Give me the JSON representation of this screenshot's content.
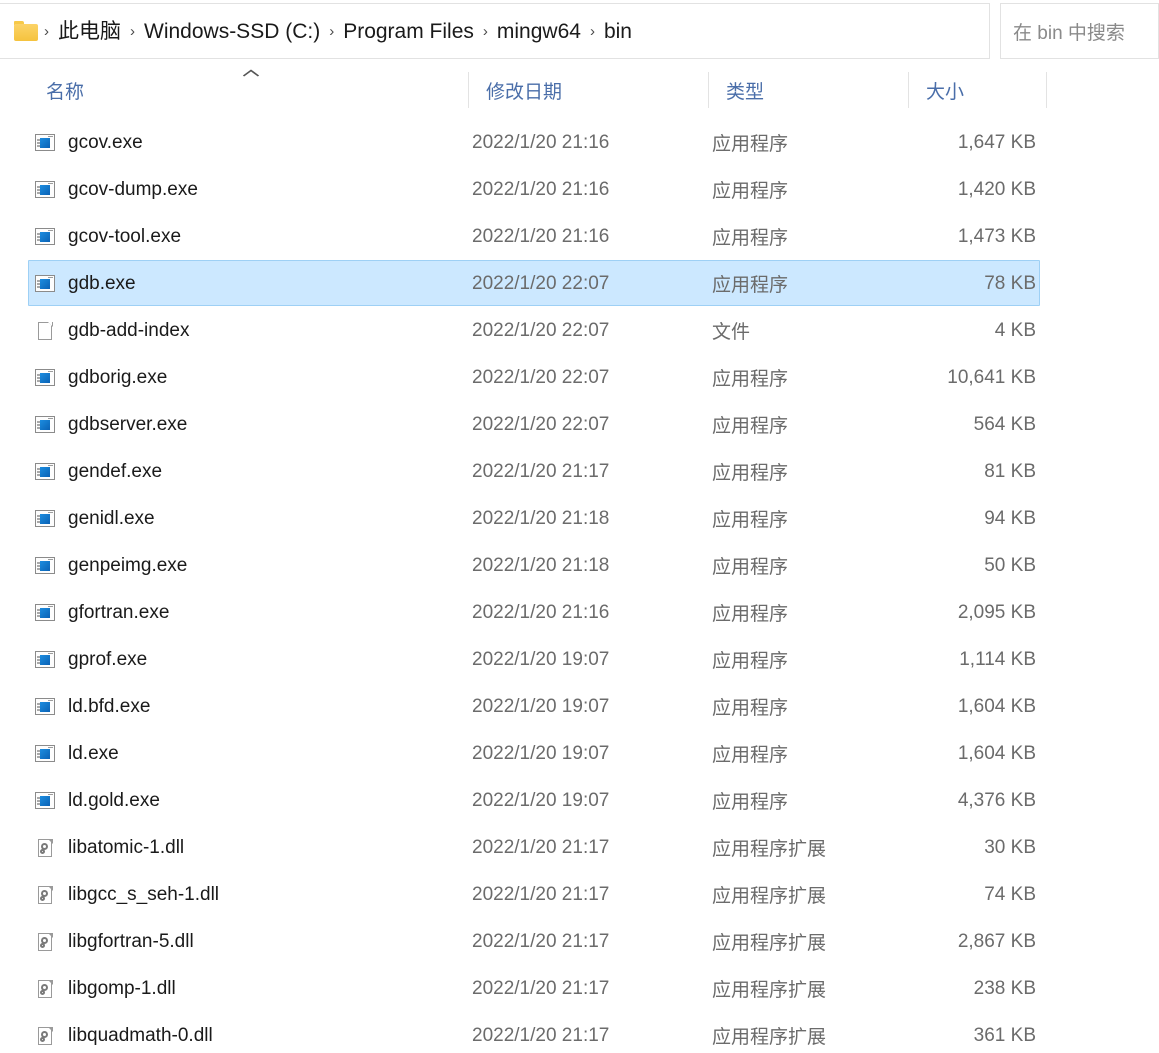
{
  "addressbar": {
    "folder_icon": "folder-icon",
    "breadcrumbs": [
      "此电脑",
      "Windows-SSD (C:)",
      "Program Files",
      "mingw64",
      "bin"
    ],
    "separator": "›",
    "dropdown_icon": "chevron-down-icon",
    "refresh_icon": "refresh-icon",
    "search_placeholder": "在 bin 中搜索"
  },
  "columns": {
    "name": "名称",
    "date": "修改日期",
    "type": "类型",
    "size": "大小",
    "sort_caret": "︿",
    "sorted_by": "名称",
    "sort_direction": "ascending"
  },
  "colors": {
    "selection_fill": "#cce8ff",
    "selection_border": "#9ed0f5",
    "header_text": "#4a6ea9",
    "primary_text": "#1a1a1a",
    "secondary_text": "#6b6b6b",
    "exe_icon_blue": "#0a62b5",
    "folder_yellow": "#f5c33e"
  },
  "files": [
    {
      "name": "gcov.exe",
      "date": "2022/1/20 21:16",
      "type": "应用程序",
      "size": "1,647 KB",
      "icon": "application-exe-icon",
      "selected": false
    },
    {
      "name": "gcov-dump.exe",
      "date": "2022/1/20 21:16",
      "type": "应用程序",
      "size": "1,420 KB",
      "icon": "application-exe-icon",
      "selected": false
    },
    {
      "name": "gcov-tool.exe",
      "date": "2022/1/20 21:16",
      "type": "应用程序",
      "size": "1,473 KB",
      "icon": "application-exe-icon",
      "selected": false
    },
    {
      "name": "gdb.exe",
      "date": "2022/1/20 22:07",
      "type": "应用程序",
      "size": "78 KB",
      "icon": "application-exe-icon",
      "selected": true
    },
    {
      "name": "gdb-add-index",
      "date": "2022/1/20 22:07",
      "type": "文件",
      "size": "4 KB",
      "icon": "generic-file-icon",
      "selected": false
    },
    {
      "name": "gdborig.exe",
      "date": "2022/1/20 22:07",
      "type": "应用程序",
      "size": "10,641 KB",
      "icon": "application-exe-icon",
      "selected": false
    },
    {
      "name": "gdbserver.exe",
      "date": "2022/1/20 22:07",
      "type": "应用程序",
      "size": "564 KB",
      "icon": "application-exe-icon",
      "selected": false
    },
    {
      "name": "gendef.exe",
      "date": "2022/1/20 21:17",
      "type": "应用程序",
      "size": "81 KB",
      "icon": "application-exe-icon",
      "selected": false
    },
    {
      "name": "genidl.exe",
      "date": "2022/1/20 21:18",
      "type": "应用程序",
      "size": "94 KB",
      "icon": "application-exe-icon",
      "selected": false
    },
    {
      "name": "genpeimg.exe",
      "date": "2022/1/20 21:18",
      "type": "应用程序",
      "size": "50 KB",
      "icon": "application-exe-icon",
      "selected": false
    },
    {
      "name": "gfortran.exe",
      "date": "2022/1/20 21:16",
      "type": "应用程序",
      "size": "2,095 KB",
      "icon": "application-exe-icon",
      "selected": false
    },
    {
      "name": "gprof.exe",
      "date": "2022/1/20 19:07",
      "type": "应用程序",
      "size": "1,114 KB",
      "icon": "application-exe-icon",
      "selected": false
    },
    {
      "name": "ld.bfd.exe",
      "date": "2022/1/20 19:07",
      "type": "应用程序",
      "size": "1,604 KB",
      "icon": "application-exe-icon",
      "selected": false
    },
    {
      "name": "ld.exe",
      "date": "2022/1/20 19:07",
      "type": "应用程序",
      "size": "1,604 KB",
      "icon": "application-exe-icon",
      "selected": false
    },
    {
      "name": "ld.gold.exe",
      "date": "2022/1/20 19:07",
      "type": "应用程序",
      "size": "4,376 KB",
      "icon": "application-exe-icon",
      "selected": false
    },
    {
      "name": "libatomic-1.dll",
      "date": "2022/1/20 21:17",
      "type": "应用程序扩展",
      "size": "30 KB",
      "icon": "dll-file-icon",
      "selected": false
    },
    {
      "name": "libgcc_s_seh-1.dll",
      "date": "2022/1/20 21:17",
      "type": "应用程序扩展",
      "size": "74 KB",
      "icon": "dll-file-icon",
      "selected": false
    },
    {
      "name": "libgfortran-5.dll",
      "date": "2022/1/20 21:17",
      "type": "应用程序扩展",
      "size": "2,867 KB",
      "icon": "dll-file-icon",
      "selected": false
    },
    {
      "name": "libgomp-1.dll",
      "date": "2022/1/20 21:17",
      "type": "应用程序扩展",
      "size": "238 KB",
      "icon": "dll-file-icon",
      "selected": false
    },
    {
      "name": "libquadmath-0.dll",
      "date": "2022/1/20 21:17",
      "type": "应用程序扩展",
      "size": "361 KB",
      "icon": "dll-file-icon",
      "selected": false
    }
  ]
}
